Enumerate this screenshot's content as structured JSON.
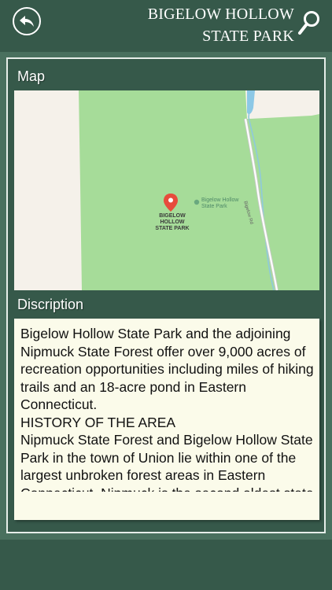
{
  "header": {
    "title_line1": "BIGELOW HOLLOW",
    "title_line2": "STATE PARK",
    "back_icon": "back-arrow-icon",
    "search_icon": "search-icon"
  },
  "map_section": {
    "label": "Map",
    "pin_label_line1": "BIGELOW HOLLOW",
    "pin_label_line2": "STATE PARK",
    "poi_label_line1": "Bigelow Hollow",
    "poi_label_line2": "State Park",
    "road_label": "Bigelow Rd"
  },
  "description_section": {
    "label": "Discription",
    "text": "Bigelow Hollow State Park and the adjoining Nipmuck State Forest offer over 9,000 acres of recreation opportunities including miles of hiking trails and an 18-acre pond in Eastern Connecticut.\nHISTORY OF THE AREA\nNipmuck State Forest and Bigelow Hollow State Park in the town of Union lie within one of the largest unbroken forest areas in Eastern Connecticut. Nipmuck is the second oldest state"
  },
  "colors": {
    "header_bg": "#36594a",
    "body_bg": "#49705e",
    "park_green": "#a6dc99",
    "pin_red": "#e74c3c",
    "desc_bg": "#fbfbea"
  }
}
